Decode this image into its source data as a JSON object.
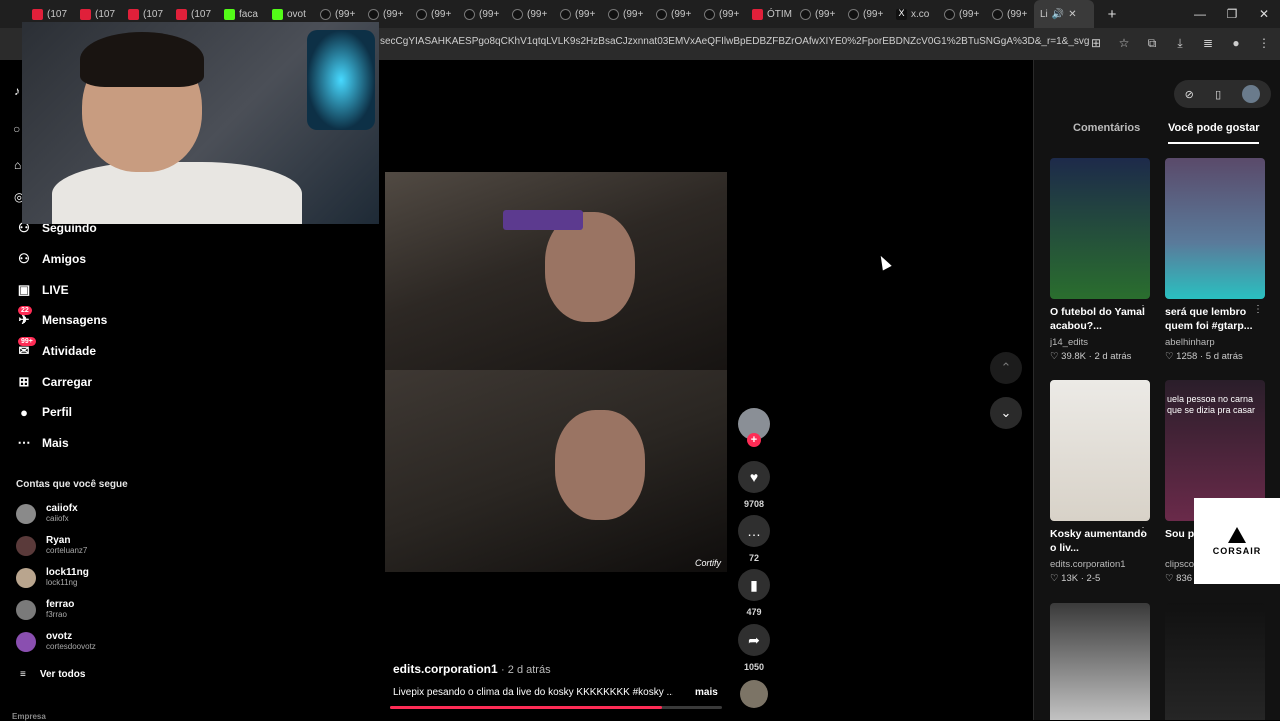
{
  "browser": {
    "tabs": [
      {
        "favicon": "yt",
        "label": "(107"
      },
      {
        "favicon": "yt",
        "label": "(107"
      },
      {
        "favicon": "yt",
        "label": "(107"
      },
      {
        "favicon": "yt",
        "label": "(107"
      },
      {
        "favicon": "kick",
        "label": "faca"
      },
      {
        "favicon": "kick",
        "label": "ovot"
      },
      {
        "favicon": "tt",
        "label": "(99+"
      },
      {
        "favicon": "tt",
        "label": "(99+"
      },
      {
        "favicon": "tt",
        "label": "(99+"
      },
      {
        "favicon": "tt",
        "label": "(99+"
      },
      {
        "favicon": "tt",
        "label": "(99+"
      },
      {
        "favicon": "tt",
        "label": "(99+"
      },
      {
        "favicon": "tt",
        "label": "(99+"
      },
      {
        "favicon": "tt",
        "label": "(99+"
      },
      {
        "favicon": "tt",
        "label": "(99+"
      },
      {
        "favicon": "yt",
        "label": "ÓTIM"
      },
      {
        "favicon": "tt",
        "label": "(99+"
      },
      {
        "favicon": "tt",
        "label": "(99+"
      },
      {
        "favicon": "x",
        "label": "x.co"
      },
      {
        "favicon": "tt",
        "label": "(99+"
      },
      {
        "favicon": "tt",
        "label": "(99+"
      }
    ],
    "active_tab_label": "Li",
    "new_tab": "+",
    "url": "secCgYIASAHKAESPgo8qCKhV1qtqLVLK9s2HzBsaCJzxnnat03EMVxAeQFIlwBpEDBZFBZrOAfwXIYE0%2FporEBDNZcV0G1%2BTuSNGgA%3D&_r=1&_svg=1&checksum=9df..."
  },
  "sidebar": {
    "nav": [
      {
        "icon": "following-icon",
        "label": "Seguindo"
      },
      {
        "icon": "friends-icon",
        "label": "Amigos"
      },
      {
        "icon": "live-icon",
        "label": "LIVE"
      },
      {
        "icon": "messages-icon",
        "label": "Mensagens",
        "badge": "22"
      },
      {
        "icon": "activity-icon",
        "label": "Atividade",
        "badge": "99+"
      },
      {
        "icon": "upload-icon",
        "label": "Carregar"
      },
      {
        "icon": "profile-icon",
        "label": "Perfil"
      },
      {
        "icon": "more-icon",
        "label": "Mais"
      }
    ],
    "following_title": "Contas que você segue",
    "accounts": [
      {
        "name": "caiiofx",
        "handle": "caiiofx"
      },
      {
        "name": "Ryan",
        "handle": "corteluanz7"
      },
      {
        "name": "lock11ng",
        "handle": "lock11ng"
      },
      {
        "name": "ferrao",
        "handle": "f3rrao"
      },
      {
        "name": "ovotz",
        "handle": "cortesdoovotz"
      }
    ],
    "see_all": "Ver todos",
    "company": "Empresa"
  },
  "video": {
    "watermark": "Cortify",
    "author": "edits.corporation1",
    "posted": "2 d atrás",
    "caption": "Livepix pesando o clima da live do kosky KKKKKKKK #kosky ...",
    "more": "mais",
    "progress": 0.82,
    "likes": "9708",
    "comments": "72",
    "saves": "479",
    "shares": "1050"
  },
  "right_panel": {
    "tabs": [
      "Comentários",
      "Você pode gostar"
    ],
    "active_tab": "Você pode gostar",
    "cards": [
      {
        "title": "O futebol do Yamal acabou?...",
        "user": "j14_edits",
        "likes": "39.8K",
        "date": "2 d atrás"
      },
      {
        "title": "será que lembro quem foi #gtarp...",
        "user": "abelhinharp",
        "likes": "1258",
        "date": "5 d atrás"
      },
      {
        "title": "Kosky aumentando o liv...",
        "user": "edits.corporation1",
        "likes": "13K",
        "date": "2-5"
      },
      {
        "title": "Sou pr... vida* a...",
        "user": "clipsco...",
        "likes": "836",
        "date": "",
        "overlay": "uela pessoa no carna que se dizia pra casar"
      }
    ]
  },
  "ad": {
    "brand": "CORSAIR"
  },
  "colors": {
    "accent": "#fe2c55",
    "bg": "#000000",
    "panel": "#121212"
  }
}
